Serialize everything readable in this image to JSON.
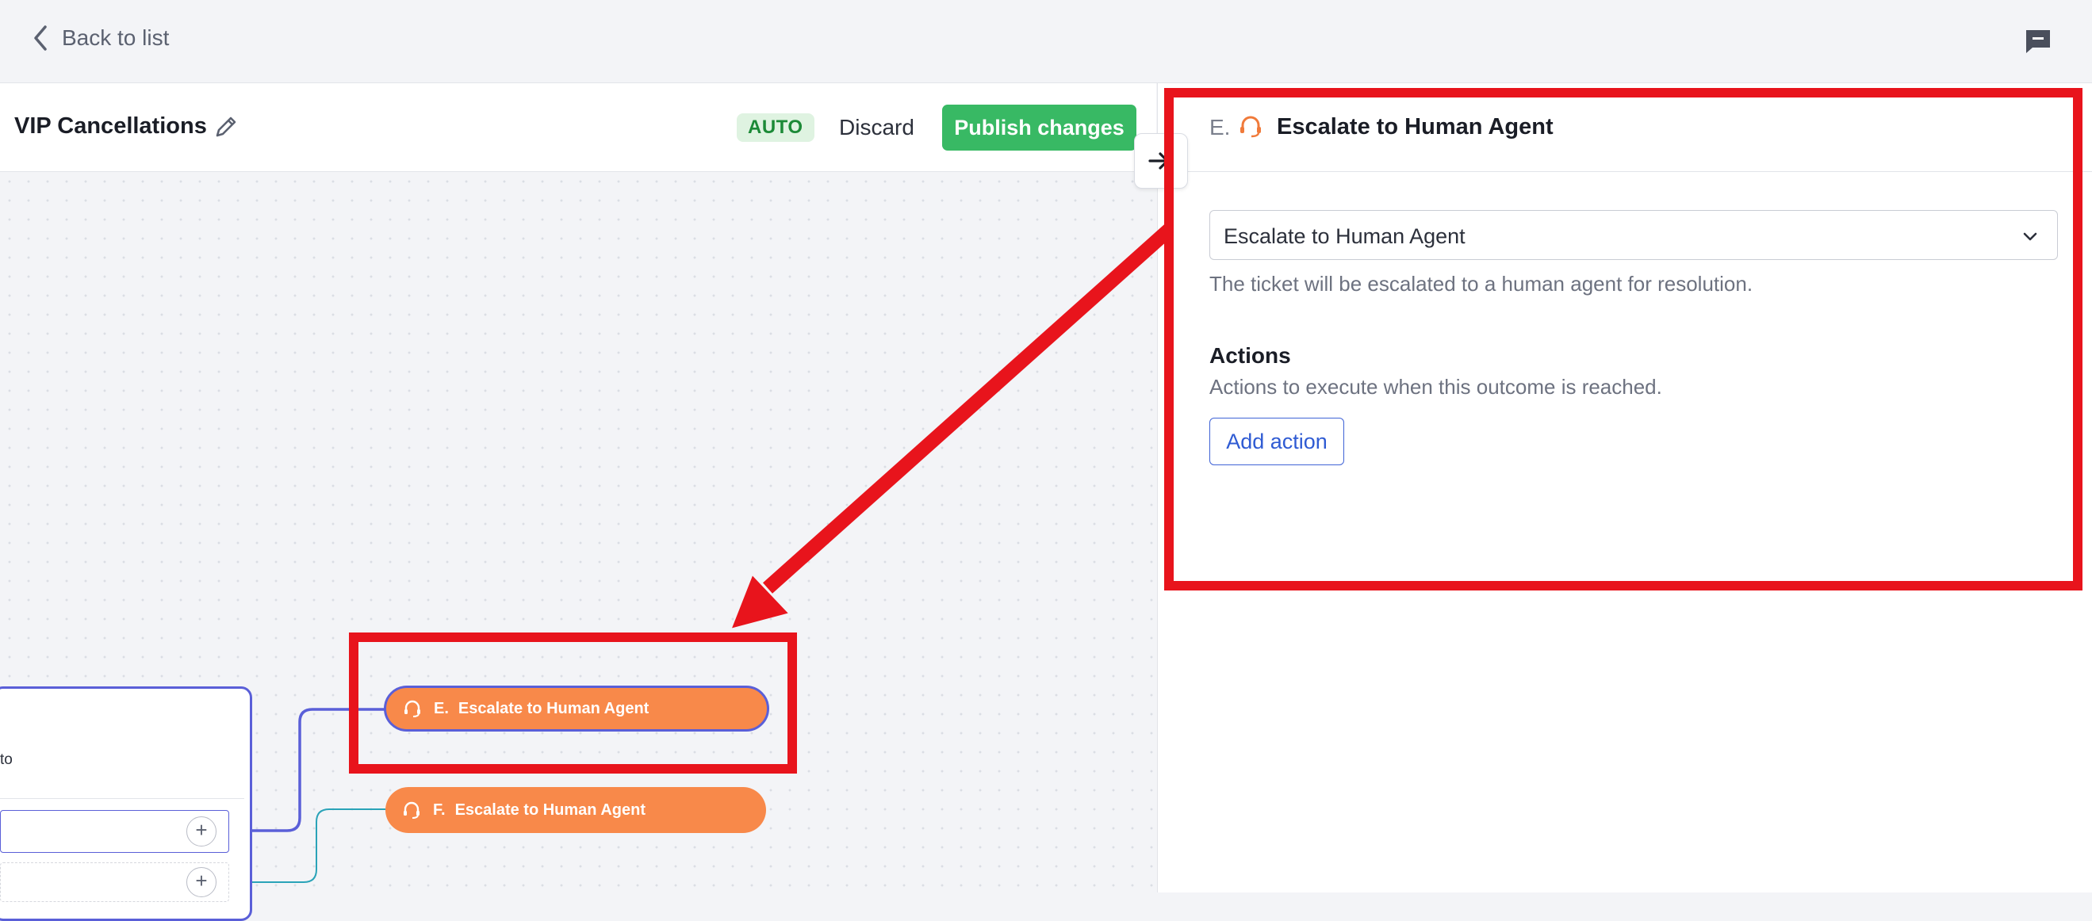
{
  "topbar": {
    "back_label": "Back to list",
    "back_icon": "chevron-left-icon",
    "chat_icon": "chat-icon"
  },
  "editor": {
    "flow_title": "VIP Cancellations",
    "mode_badge": "AUTO",
    "discard_label": "Discard",
    "publish_label": "Publish changes"
  },
  "canvas": {
    "card_text": "to",
    "plus_symbol": "+",
    "nodes": [
      {
        "letter": "E.",
        "label": "Escalate to Human Agent",
        "selected": true
      },
      {
        "letter": "F.",
        "label": "Escalate to Human Agent",
        "selected": false
      }
    ]
  },
  "panel": {
    "prefix": "E.",
    "title": "Escalate to Human Agent",
    "outcome_value": "Escalate to Human Agent",
    "outcome_description": "The ticket will be escalated to a human agent for resolution.",
    "actions_heading": "Actions",
    "actions_description": "Actions to execute when this outcome is reached.",
    "add_action_label": "Add action"
  },
  "colors": {
    "accent_green": "#38b964",
    "node_orange": "#f8894a",
    "selection_blue": "#5a5fd8",
    "annotation_red": "#e8141c",
    "link_blue": "#2f5bd3",
    "wire_teal": "#2aa3b8"
  }
}
